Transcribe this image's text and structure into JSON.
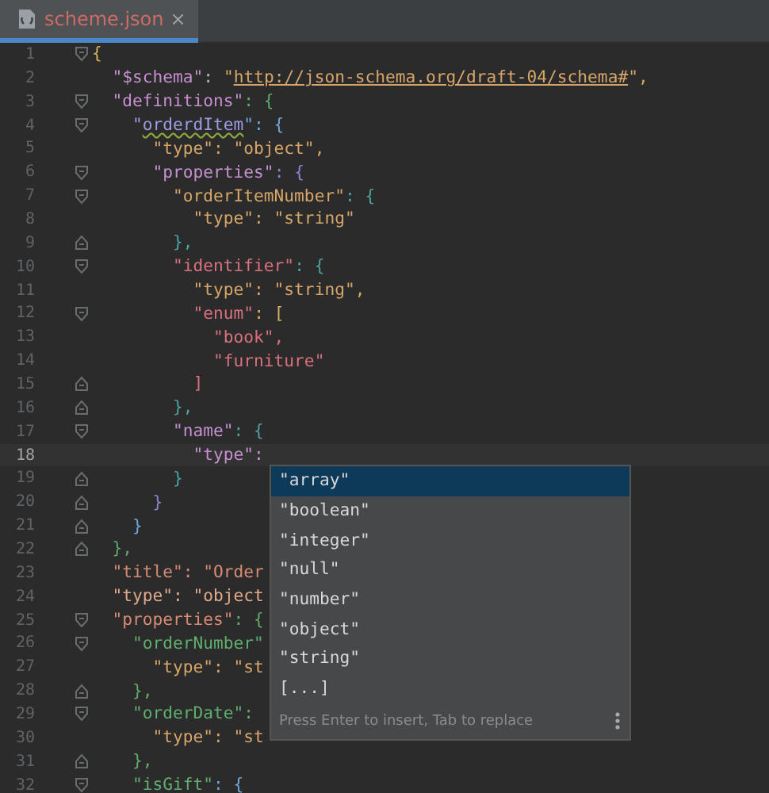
{
  "tabs": [
    {
      "label": "scheme.json",
      "selected": true,
      "close": "×"
    }
  ],
  "lines": [
    {
      "number": "1",
      "kind": "open",
      "current": false,
      "tokens": [
        {
          "t": "{",
          "color": "#d9b15c"
        }
      ]
    },
    {
      "number": "2",
      "kind": "plain",
      "current": false,
      "tokens": [
        {
          "t": "  \"$schema\"",
          "color": "#c58fd0"
        },
        {
          "t": ": ",
          "color": "#a9b7c6"
        },
        {
          "t": "\"",
          "color": "#d6a569"
        },
        {
          "t": "http://json-schema.org/draft-04/schema#",
          "color": "#d6a569",
          "kind": "link"
        },
        {
          "t": "\",",
          "color": "#d6a569"
        }
      ]
    },
    {
      "number": "3",
      "kind": "open",
      "current": false,
      "tokens": [
        {
          "t": "  \"definitions\"",
          "color": "#c58fd0"
        },
        {
          "t": ": {",
          "color": "#5fa96f"
        }
      ]
    },
    {
      "number": "4",
      "kind": "open",
      "current": false,
      "tokens": [
        {
          "t": "    \"",
          "color": "#9d9be2"
        },
        {
          "t": "orderdItem",
          "color": "#9d9be2",
          "kind": "typo"
        },
        {
          "t": "\": {",
          "color": "#6fa6dc"
        }
      ]
    },
    {
      "number": "5",
      "kind": "plain",
      "current": false,
      "tokens": [
        {
          "t": "      \"type\": \"object\",",
          "color": "#d6a569"
        }
      ]
    },
    {
      "number": "6",
      "kind": "open",
      "current": false,
      "tokens": [
        {
          "t": "      \"properties\"",
          "color": "#c58fd0"
        },
        {
          "t": ": {",
          "color": "#8a86d6"
        }
      ]
    },
    {
      "number": "7",
      "kind": "open",
      "current": false,
      "tokens": [
        {
          "t": "        \"orderItemNumber\"",
          "color": "#d6a569"
        },
        {
          "t": ": {",
          "color": "#4aa3a0"
        }
      ]
    },
    {
      "number": "8",
      "kind": "plain",
      "current": false,
      "tokens": [
        {
          "t": "          \"type\": \"string\"",
          "color": "#d6a569"
        }
      ]
    },
    {
      "number": "9",
      "kind": "close",
      "current": false,
      "tokens": [
        {
          "t": "        },",
          "color": "#4aa3a0"
        }
      ]
    },
    {
      "number": "10",
      "kind": "open",
      "current": false,
      "tokens": [
        {
          "t": "        \"identifier\"",
          "color": "#d9707e"
        },
        {
          "t": ": {",
          "color": "#4aa3a0"
        }
      ]
    },
    {
      "number": "11",
      "kind": "plain",
      "current": false,
      "tokens": [
        {
          "t": "          \"type\": \"string\",",
          "color": "#d6a569"
        }
      ]
    },
    {
      "number": "12",
      "kind": "open",
      "current": false,
      "tokens": [
        {
          "t": "          \"enum\"",
          "color": "#d9707e"
        },
        {
          "t": ": [",
          "color": "#d9b15c"
        }
      ]
    },
    {
      "number": "13",
      "kind": "plain",
      "current": false,
      "tokens": [
        {
          "t": "            \"book\",",
          "color": "#d9707e"
        }
      ]
    },
    {
      "number": "14",
      "kind": "plain",
      "current": false,
      "tokens": [
        {
          "t": "            \"furniture\"",
          "color": "#d9707e"
        }
      ]
    },
    {
      "number": "15",
      "kind": "close",
      "current": false,
      "tokens": [
        {
          "t": "          ]",
          "color": "#d9707e"
        }
      ]
    },
    {
      "number": "16",
      "kind": "close",
      "current": false,
      "tokens": [
        {
          "t": "        },",
          "color": "#4aa3a0"
        }
      ]
    },
    {
      "number": "17",
      "kind": "open",
      "current": false,
      "tokens": [
        {
          "t": "        \"name\"",
          "color": "#c58fd0"
        },
        {
          "t": ": {",
          "color": "#4aa3a0"
        }
      ]
    },
    {
      "number": "18",
      "kind": "plain",
      "current": true,
      "tokens": [
        {
          "t": "          \"type\":",
          "color": "#c58fd0"
        }
      ]
    },
    {
      "number": "19",
      "kind": "close",
      "current": false,
      "tokens": [
        {
          "t": "        }",
          "color": "#4aa3a0"
        }
      ]
    },
    {
      "number": "20",
      "kind": "close",
      "current": false,
      "tokens": [
        {
          "t": "      }",
          "color": "#8a86d6"
        }
      ]
    },
    {
      "number": "21",
      "kind": "close",
      "current": false,
      "tokens": [
        {
          "t": "    }",
          "color": "#6fa6dc"
        }
      ]
    },
    {
      "number": "22",
      "kind": "close",
      "current": false,
      "tokens": [
        {
          "t": "  },",
          "color": "#5fa96f"
        }
      ]
    },
    {
      "number": "23",
      "kind": "plain",
      "current": false,
      "tokens": [
        {
          "t": "  \"title\": \"Order",
          "color": "#d98a72"
        }
      ]
    },
    {
      "number": "24",
      "kind": "plain",
      "current": false,
      "tokens": [
        {
          "t": "  \"type\": \"object",
          "color": "#e0a98c"
        }
      ]
    },
    {
      "number": "25",
      "kind": "open",
      "current": false,
      "tokens": [
        {
          "t": "  \"properties\"",
          "color": "#d98a72"
        },
        {
          "t": ": {",
          "color": "#5fa96f"
        }
      ]
    },
    {
      "number": "26",
      "kind": "open",
      "current": false,
      "tokens": [
        {
          "t": "    \"orderNumber\"",
          "color": "#5fae6f"
        }
      ]
    },
    {
      "number": "27",
      "kind": "plain",
      "current": false,
      "tokens": [
        {
          "t": "      \"type\": \"st",
          "color": "#d6a569"
        }
      ]
    },
    {
      "number": "28",
      "kind": "close",
      "current": false,
      "tokens": [
        {
          "t": "    },",
          "color": "#5fae6f"
        }
      ]
    },
    {
      "number": "29",
      "kind": "open",
      "current": false,
      "tokens": [
        {
          "t": "    \"orderDate\":",
          "color": "#5fae6f"
        }
      ]
    },
    {
      "number": "30",
      "kind": "plain",
      "current": false,
      "tokens": [
        {
          "t": "      \"type\": \"st",
          "color": "#d6a569"
        }
      ]
    },
    {
      "number": "31",
      "kind": "close",
      "current": false,
      "tokens": [
        {
          "t": "    },",
          "color": "#5fae6f"
        }
      ]
    },
    {
      "number": "32",
      "kind": "open",
      "current": false,
      "tokens": [
        {
          "t": "    \"isGift\"",
          "color": "#5fae6f"
        },
        {
          "t": ": {",
          "color": "#6fa6dc"
        }
      ]
    }
  ],
  "completion": {
    "items": [
      {
        "label": "\"array\"",
        "selected": true
      },
      {
        "label": "\"boolean\"",
        "selected": false
      },
      {
        "label": "\"integer\"",
        "selected": false
      },
      {
        "label": "\"null\"",
        "selected": false
      },
      {
        "label": "\"number\"",
        "selected": false
      },
      {
        "label": "\"object\"",
        "selected": false
      },
      {
        "label": "\"string\"",
        "selected": false
      },
      {
        "label": "[...]",
        "selected": false
      }
    ],
    "hint": "Press Enter to insert, Tab to replace"
  }
}
